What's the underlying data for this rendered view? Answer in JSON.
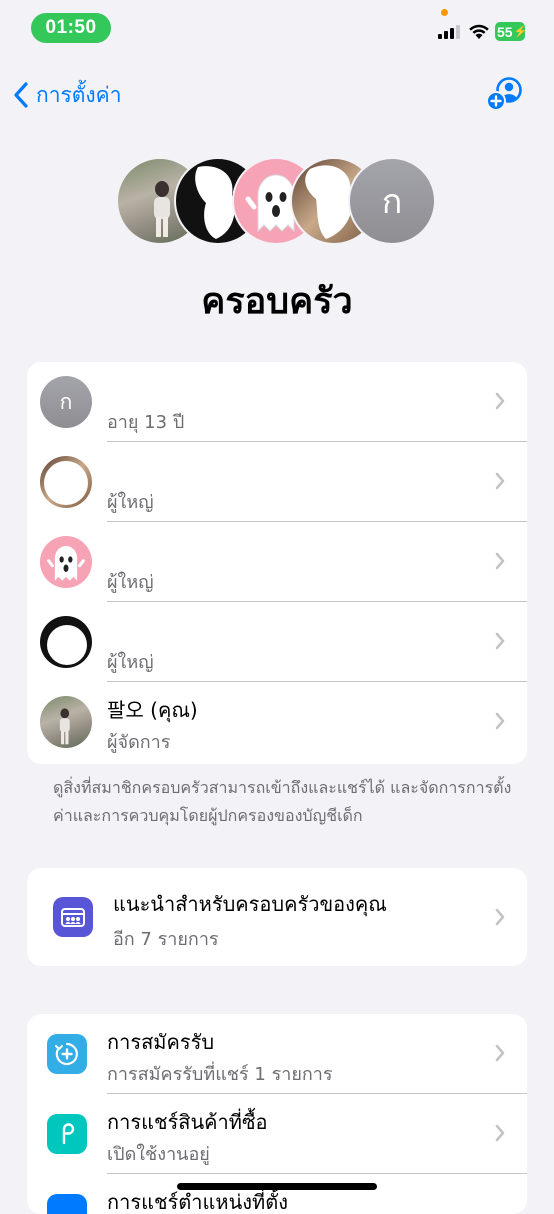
{
  "status_bar": {
    "time": "01:50",
    "battery": "55"
  },
  "nav": {
    "back_label": "การตั้งค่า"
  },
  "family": {
    "title": "ครอบครัว",
    "initial": "ก",
    "members": [
      {
        "initial": "ก",
        "name": "",
        "role": "อายุ 13 ปี"
      },
      {
        "name": "",
        "role": "ผู้ใหญ่"
      },
      {
        "name": "",
        "role": "ผู้ใหญ่"
      },
      {
        "name": "",
        "role": "ผู้ใหญ่"
      },
      {
        "name": "팔오 (คุณ)",
        "role": "ผู้จัดการ"
      }
    ],
    "footnote": "ดูสิ่งที่สมาชิกครอบครัวสามารถเข้าถึงและแชร์ได้ และจัดการการตั้งค่าและการควบคุมโดยผู้ปกครองของบัญชีเด็ก"
  },
  "suggestions": {
    "title": "แนะนำสำหรับครอบครัวของคุณ",
    "subtitle": "อีก 7 รายการ"
  },
  "services": [
    {
      "title": "การสมัครรับ",
      "subtitle": "การสมัครรับที่แชร์ 1 รายการ"
    },
    {
      "title": "การแชร์สินค้าที่ซื้อ",
      "subtitle": "เปิดใช้งานอยู่"
    },
    {
      "title": "การแชร์ตำแหน่งที่ตั้ง",
      "subtitle": ""
    }
  ],
  "colors": {
    "accent": "#007aff",
    "time_pill": "#34c759",
    "suggestions_icon": "#5856d6",
    "subscriptions_icon": "#32ade6",
    "purchases_icon": "#00c7be",
    "location_icon": "#007aff"
  }
}
